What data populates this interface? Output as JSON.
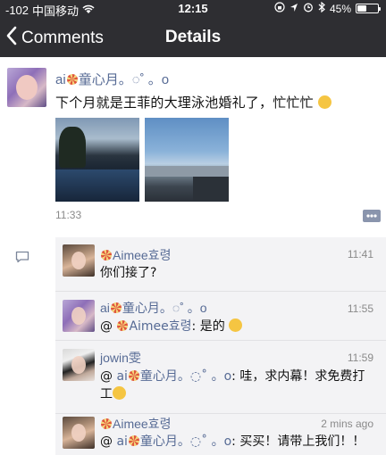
{
  "status_bar": {
    "signal": "-102",
    "carrier": "中国移动",
    "time": "12:15",
    "battery": "45%",
    "battery_level": 0.45
  },
  "nav": {
    "back_label": "Comments",
    "title": "Details"
  },
  "post": {
    "author": "ai",
    "author_suffix": "童心月。◌˚ 。o",
    "text": "下个月就是王菲的大理泳池婚礼了，忙忙忙",
    "time": "11:33"
  },
  "comments": [
    {
      "name_prefix": "",
      "name": "Aimee효령",
      "time": "11:41",
      "text": "你们接了?"
    },
    {
      "name_prefix": "ai",
      "name": "童心月。◌˚ 。o",
      "time": "11:55",
      "reply_to": "Aimee효령",
      "text": ": 是的"
    },
    {
      "name_prefix": "",
      "name": "jowin雯",
      "time": "11:59",
      "reply_prefix": "ai",
      "reply_to": "童心月。◌˚ 。o",
      "text": ": 哇，求内幕！求免费打工"
    },
    {
      "name_prefix": "",
      "name": "Aimee효령",
      "time": "2 mins ago",
      "reply_prefix": "ai",
      "reply_to": "童心月。◌˚ 。o",
      "text": ": 买买！请带上我们！！"
    }
  ]
}
